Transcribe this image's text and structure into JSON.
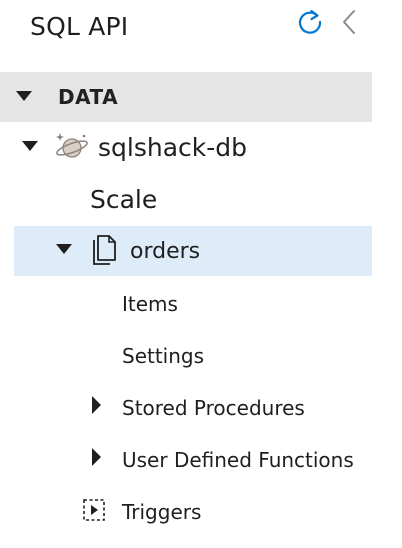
{
  "header": {
    "title": "SQL API"
  },
  "section": {
    "label": "DATA"
  },
  "tree": {
    "database": "sqlshack-db",
    "scale": "Scale",
    "container": "orders",
    "items": "Items",
    "settings": "Settings",
    "stored_procedures": "Stored Procedures",
    "udfs": "User Defined Functions",
    "triggers": "Triggers"
  },
  "icons": {
    "refresh": "refresh-icon",
    "collapse": "chevron-left-icon",
    "database": "planet-icon",
    "container": "documents-icon",
    "triggers": "trigger-icon"
  },
  "colors": {
    "accent": "#0078d4",
    "selected_bg": "#deecf9",
    "section_bg": "#e5e5e5"
  }
}
